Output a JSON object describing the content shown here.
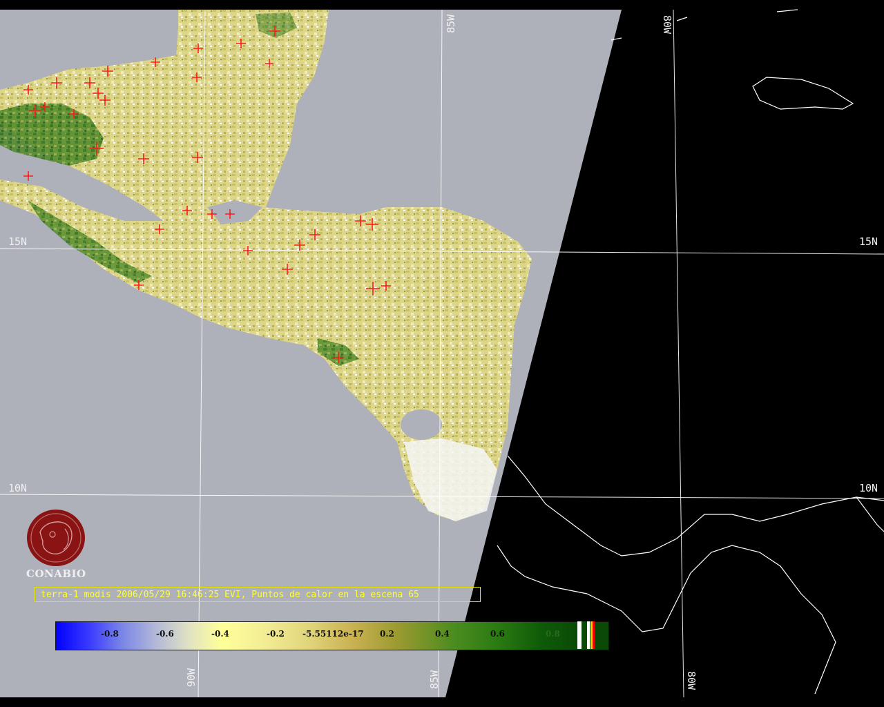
{
  "map": {
    "grid_labels": {
      "lat_15_left": "15N",
      "lat_15_right": "15N",
      "lat_10_left": "10N",
      "lat_10_right": "10N",
      "lon_85_top": "85W",
      "lon_80_top": "80W",
      "lon_90_bottom": "90W",
      "lon_85_bottom": "85W",
      "lon_80_bottom": "80W"
    },
    "caption": "terra-1 modis 2006/05/29 16:46:25 EVI, Puntos de calor en la escena 65",
    "logo": {
      "text": "CONABIO",
      "icon": "conabio-seal-icon"
    },
    "colorbar": {
      "ticks": [
        "-0.8",
        "-0.6",
        "-0.4",
        "-0.2",
        "-5.55112e-17",
        "0.2",
        "0.4",
        "0.6",
        "0.8"
      ]
    },
    "colors": {
      "background": "#000000",
      "scene_no_data": "#aeb0ba",
      "vegetation_low": "#e4dc8c",
      "vegetation_high": "#2e7a18",
      "hotspot": "#ff1a1a",
      "caption": "#ffff33",
      "grid": "#ffffff"
    }
  }
}
